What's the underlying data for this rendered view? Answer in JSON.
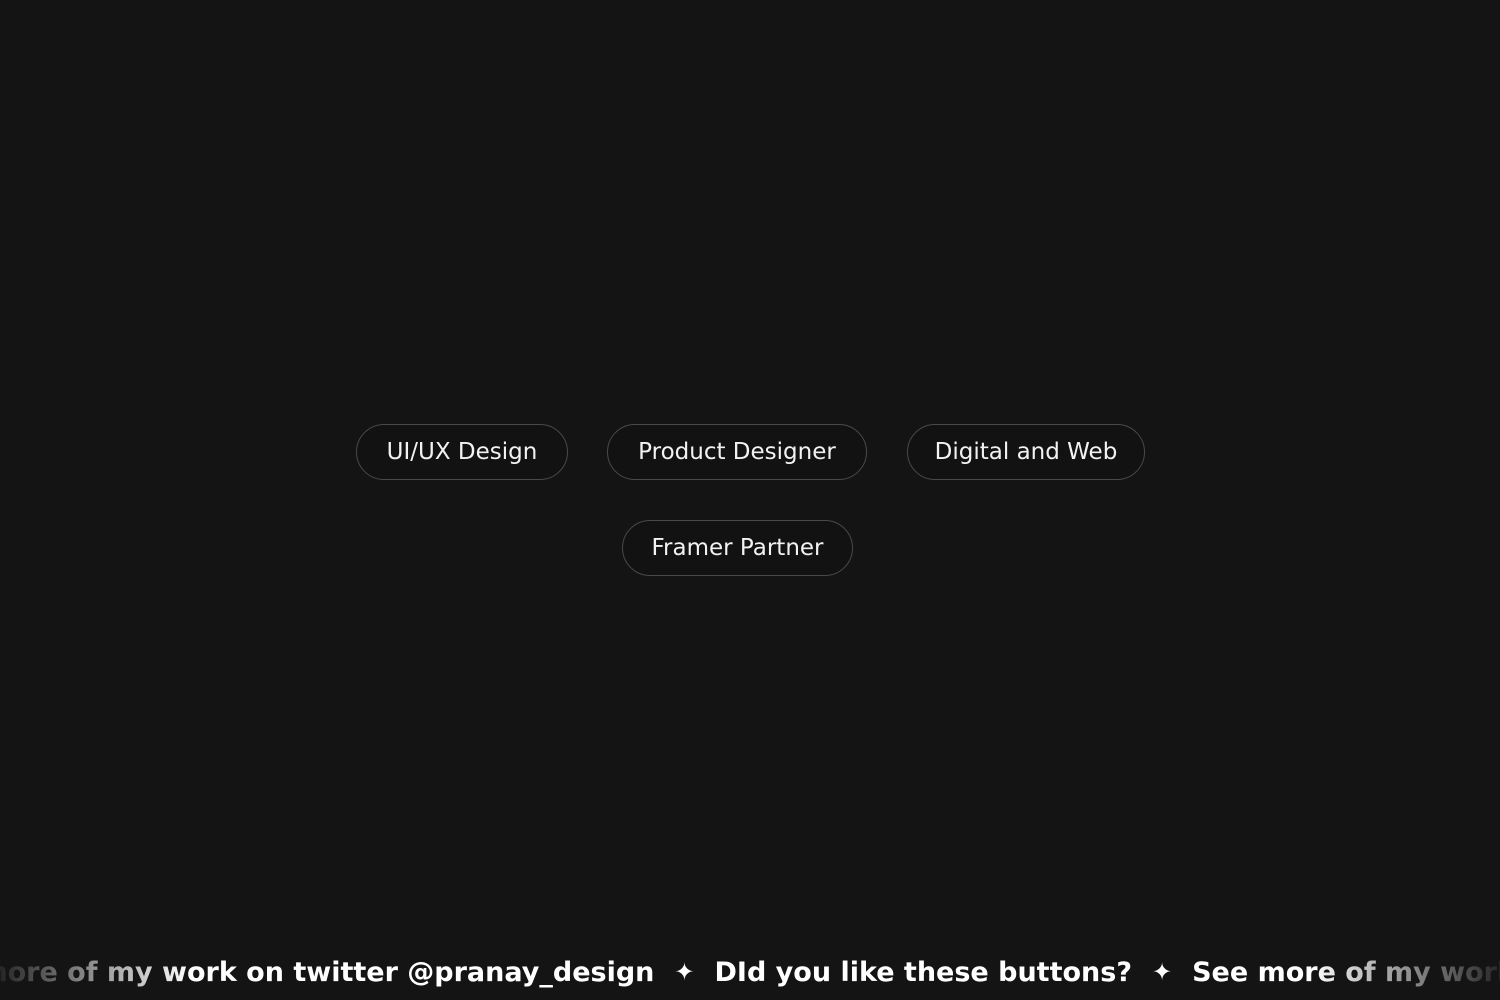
{
  "pills": [
    {
      "label": "UI/UX Design"
    },
    {
      "label": "Product Designer"
    },
    {
      "label": "Digital and Web"
    },
    {
      "label": "Framer Partner"
    }
  ],
  "marquee": {
    "message_1": "See more of my work on twitter @pranay_design",
    "message_2": "DId you like these buttons?",
    "separator_glyph": "✦"
  },
  "colors": {
    "background": "#141414",
    "pill_border": "#4a4a4a",
    "text": "#f2f2f2"
  }
}
